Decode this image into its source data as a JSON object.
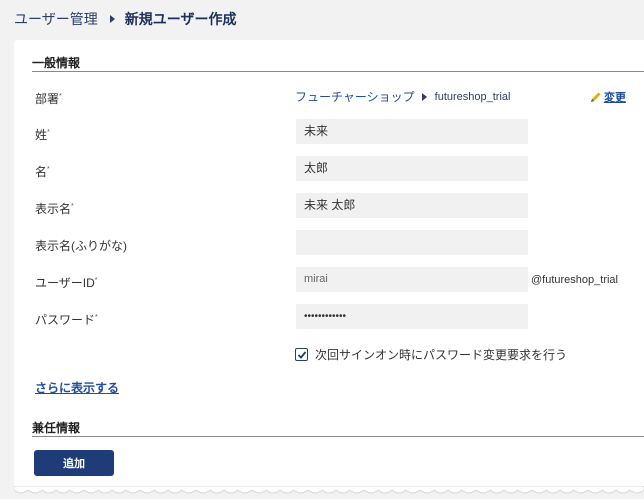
{
  "breadcrumb": {
    "root": "ユーザー管理",
    "current": "新規ユーザー作成"
  },
  "general": {
    "title": "一般情報",
    "department": {
      "label": "部署",
      "shop": "フューチャーショップ",
      "code": "futureshop_trial",
      "change_label": "変更"
    },
    "last_name": {
      "label": "姓",
      "value": "未来"
    },
    "first_name": {
      "label": "名",
      "value": "太郎"
    },
    "display_name": {
      "label": "表示名",
      "value": "未来 太郎"
    },
    "display_name_kana": {
      "label": "表示名(ふりがな)",
      "value": ""
    },
    "user_id": {
      "label": "ユーザーID",
      "value": "mirai",
      "suffix": "@futureshop_trial"
    },
    "password": {
      "label": "パスワード",
      "value": "••••••••••••"
    },
    "require_change": {
      "label": "次回サインオン時にパスワード変更要求を行う",
      "checked": true
    },
    "more_link": "さらに表示する"
  },
  "concurrent": {
    "title": "兼任情報",
    "add_label": "追加"
  },
  "colors": {
    "primary": "#1d3c78",
    "link": "#1e4d9c",
    "field_bg": "#f1f1f2",
    "pencil": "#f0a500"
  },
  "required_mark": "*"
}
